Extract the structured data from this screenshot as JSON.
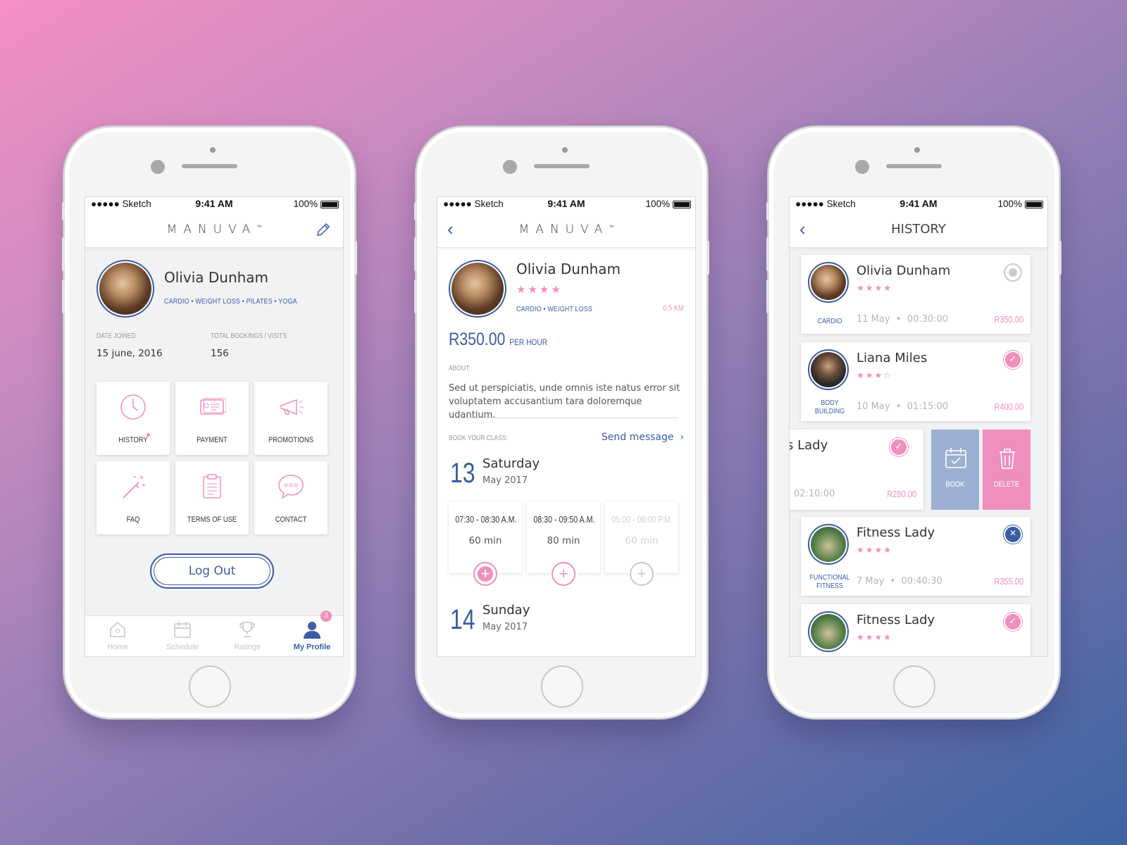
{
  "colors": {
    "accent_blue": "#3a5da4",
    "accent_pink": "#ef8fbd"
  },
  "status_bar": {
    "carrier": "●●●●● Sketch",
    "time": "9:41 AM",
    "battery": "100%"
  },
  "phone1": {
    "logo": "MANUVA",
    "logo_tm": "™",
    "edit_icon": "pencil-icon",
    "profile": {
      "name": "Olivia Dunham",
      "tags": "CARDIO  •  WEIGHT LOSS  •  PILATES  •  YOGA"
    },
    "stats": {
      "date_joined_label": "DATE JOINED",
      "date_joined": "15 june, 2016",
      "total_label": "TOTAL BOOKINGS / VISITS",
      "total": "156"
    },
    "tiles": [
      {
        "label": "HISTORY",
        "icon": "clock-icon"
      },
      {
        "label": "PAYMENT",
        "icon": "card-icon"
      },
      {
        "label": "PROMOTIONS",
        "icon": "megaphone-icon"
      },
      {
        "label": "FAQ",
        "icon": "magic-wand-icon"
      },
      {
        "label": "TERMS OF USE",
        "icon": "clipboard-icon"
      },
      {
        "label": "CONTACT",
        "icon": "chat-bubble-icon"
      }
    ],
    "logout": "Log Out",
    "tabs": [
      {
        "label": "Home",
        "icon": "home-icon"
      },
      {
        "label": "Schedule",
        "icon": "calendar-icon"
      },
      {
        "label": "Ratings",
        "icon": "trophy-icon"
      },
      {
        "label": "My Profile",
        "icon": "user-icon",
        "badge": "3",
        "active": true
      }
    ]
  },
  "phone2": {
    "logo": "MANUVA",
    "logo_tm": "™",
    "name": "Olivia Dunham",
    "rating": 4,
    "stars": "★★★★",
    "tags": "CARDIO  •  WEIGHT LOSS",
    "distance": "0,5 KM",
    "price": "R350.00",
    "price_unit": "PER HOUR",
    "about_label": "ABOUT:",
    "about": "Sed ut perspiciatis, unde omnis iste natus error sit voluptatem accusantium tara doloremque udantium.",
    "book_label": "BOOK YOUR CLASS:",
    "send_message": "Send message",
    "days": [
      {
        "num": "13",
        "name": "Saturday",
        "month": "May 2017"
      },
      {
        "num": "14",
        "name": "Sunday",
        "month": "May 2017"
      }
    ],
    "slots": [
      {
        "time": "07:30 - 08:30 A.M.",
        "duration": "60 min",
        "state": "selected"
      },
      {
        "time": "08:30 - 09:50 A.M.",
        "duration": "80 min",
        "state": "available"
      },
      {
        "time": "05:00 - 06:00 P.M.",
        "duration": "60 min",
        "state": "unavailable"
      }
    ]
  },
  "phone3": {
    "title": "HISTORY",
    "cards": [
      {
        "name": "Olivia Dunham",
        "stars": "★★★★",
        "category": "CARDIO",
        "date": "11 May",
        "duration": "00:30:00",
        "price": "R350.00",
        "status": "pending"
      },
      {
        "name": "Liana Miles",
        "stars": "★★★☆",
        "category": "BODY BUILDING",
        "date": "10 May",
        "duration": "01:15:00",
        "price": "R400.00",
        "status": "done"
      },
      {
        "name": "s Lady",
        "stars": "",
        "category": "",
        "date": "",
        "duration": "02:10:00",
        "price": "R280.00",
        "status": "done"
      },
      {
        "name": "Fitness Lady",
        "stars": "★★★★",
        "category": "FUNCTIONAL FITNESS",
        "date": "7 May",
        "duration": "00:40:30",
        "price": "R355.00",
        "status": "cancelled"
      },
      {
        "name": "Fitness Lady",
        "stars": "★★★★",
        "category": "",
        "date": "",
        "duration": "",
        "price": "",
        "status": "done"
      }
    ],
    "actions": {
      "book": "BOOK",
      "delete": "DELETE"
    },
    "separator": "•"
  }
}
